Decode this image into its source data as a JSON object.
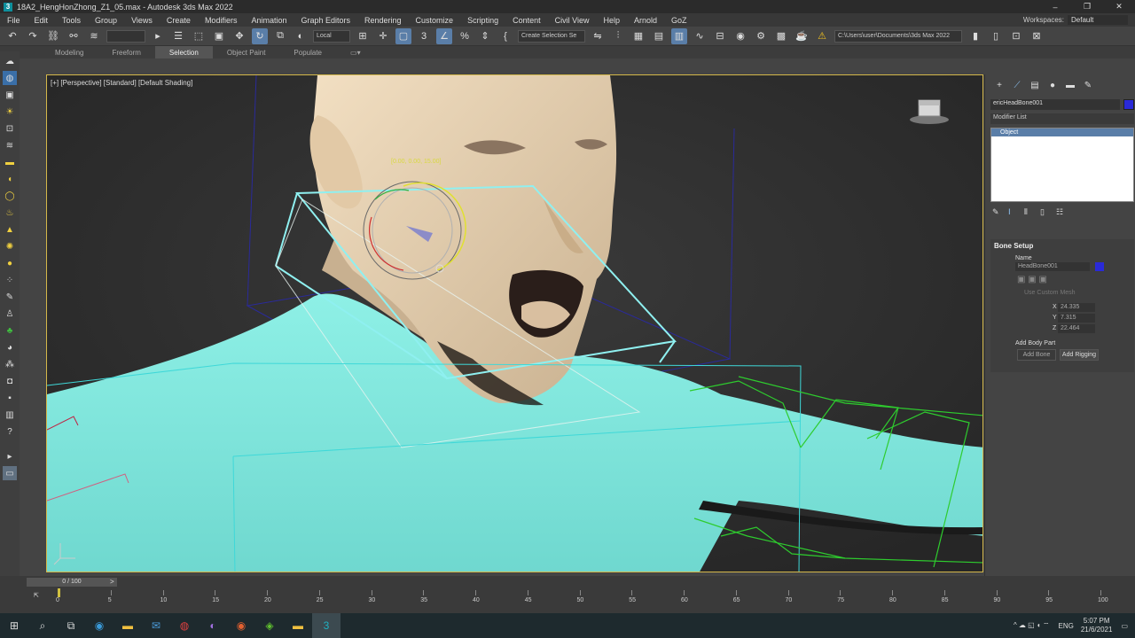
{
  "window": {
    "title": "18A2_HengHonZhong_Z1_05.max - Autodesk 3ds Max 2022",
    "controls": [
      "–",
      "❐",
      "✕"
    ]
  },
  "menu": [
    "File",
    "Edit",
    "Tools",
    "Group",
    "Views",
    "Create",
    "Modifiers",
    "Animation",
    "Graph Editors",
    "Rendering",
    "Customize",
    "Scripting",
    "Content",
    "Civil View",
    "Help",
    "Arnold",
    "GoZ"
  ],
  "workspace": {
    "label": "Workspaces:",
    "value": "Default"
  },
  "toolbar": {
    "coord_system": "Local",
    "selection_set": "Create Selection Se",
    "project_path": "C:\\Users\\user\\Documents\\3ds Max 2022"
  },
  "ribbon": {
    "tabs": [
      "Modeling",
      "Freeform",
      "Selection",
      "Object Paint",
      "Populate"
    ],
    "active": "Selection"
  },
  "viewport": {
    "label": "[+] [Perspective] [Standard] [Default Shading]",
    "coord_readout": "[0.00, 0.00, 15.00]"
  },
  "command_panel": {
    "object_name": "ericHeadBone001",
    "object_color": "#2a2ad8",
    "modifier_list": "Modifier List",
    "stack_item": "Object",
    "bone_setup": {
      "title": "Bone Setup",
      "name_label": "Name",
      "name_value": "HeadBone001",
      "use_custom_mesh": "Use Custom Mesh",
      "x_label": "X",
      "x_value": "24.335",
      "y_label": "Y",
      "y_value": "7.315",
      "z_label": "Z",
      "z_value": "22.464",
      "add_body_part": "Add Body Part",
      "add_bone": "Add Bone",
      "add_rigging": "Add Rigging"
    }
  },
  "timeline": {
    "frame": "0 / 100",
    "ticks": [
      "0",
      "5",
      "10",
      "15",
      "20",
      "25",
      "30",
      "35",
      "40",
      "45",
      "50",
      "55",
      "60",
      "65",
      "70",
      "75",
      "80",
      "85",
      "90",
      "95",
      "100"
    ]
  },
  "taskbar": {
    "lang": "ENG",
    "time": "5:07 PM",
    "date": "21/6/2021"
  },
  "colors": {
    "body": "#7de8df",
    "skin": "#eed8b8",
    "selection_box": "#8ff0f0",
    "bone_green": "#2ecc2e",
    "accent": "#5a7ea8"
  }
}
